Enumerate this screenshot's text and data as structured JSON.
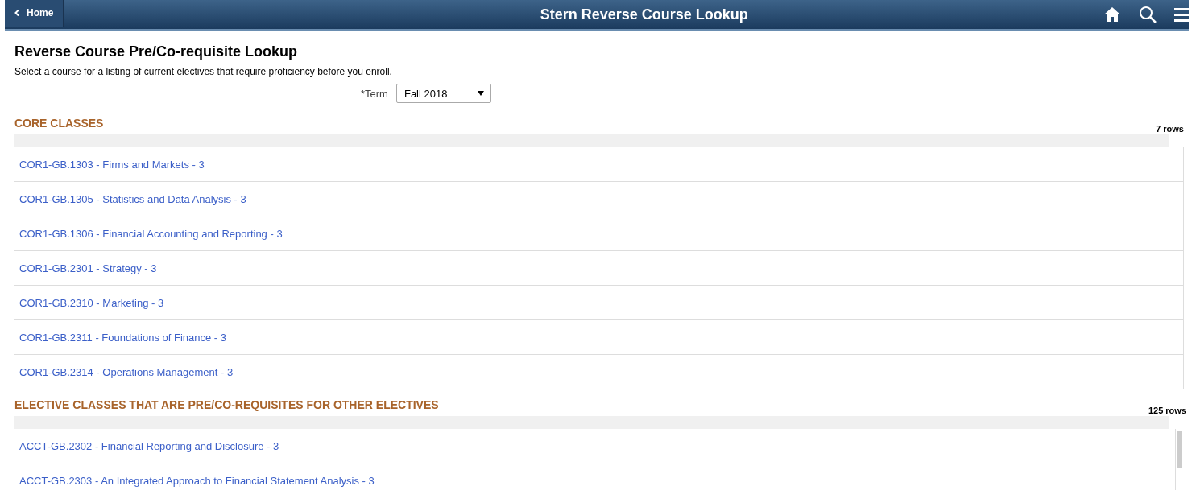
{
  "header": {
    "back_button": "Home",
    "title": "Stern Reverse Course Lookup"
  },
  "page": {
    "title": "Reverse Course Pre/Co-requisite Lookup",
    "instructions": "Select a course for a listing of current electives that require proficiency before you enroll."
  },
  "term": {
    "label": "*Term",
    "value": "Fall 2018"
  },
  "sections": [
    {
      "title": "CORE CLASSES",
      "row_count": "7 rows",
      "scrollable": false,
      "rows": [
        "COR1-GB.1303 - Firms and Markets - 3",
        "COR1-GB.1305 - Statistics and Data Analysis - 3",
        "COR1-GB.1306 - Financial Accounting and Reporting - 3",
        "COR1-GB.2301 - Strategy - 3",
        "COR1-GB.2310 - Marketing - 3",
        "COR1-GB.2311 - Foundations of Finance - 3",
        "COR1-GB.2314 - Operations Management - 3"
      ]
    },
    {
      "title": "ELECTIVE CLASSES THAT ARE PRE/CO-REQUISITES FOR OTHER ELECTIVES",
      "row_count": "125 rows",
      "scrollable": true,
      "rows": [
        "ACCT-GB.2302 - Financial Reporting and Disclosure - 3",
        "ACCT-GB.2303 - An Integrated Approach to Financial Statement Analysis - 3"
      ]
    }
  ]
}
